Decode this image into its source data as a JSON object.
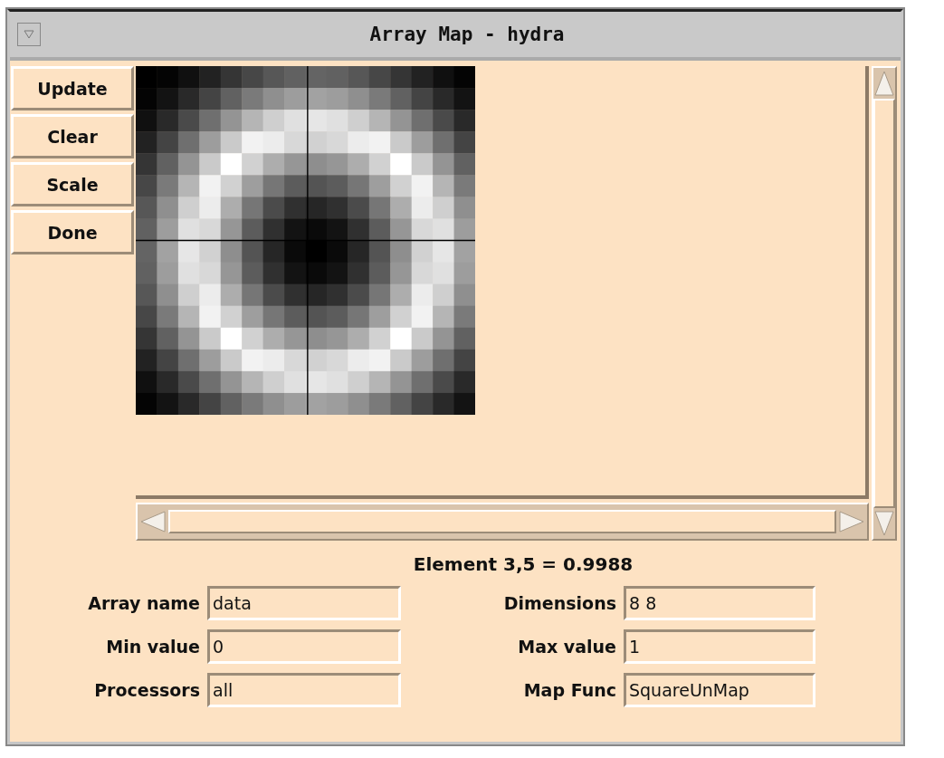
{
  "window": {
    "title": "Array Map - hydra"
  },
  "buttons": [
    "Update",
    "Clear",
    "Scale",
    "Done"
  ],
  "readout": "Element 3,5 = 0.9988",
  "fields": [
    {
      "label": "Array name",
      "value": "data"
    },
    {
      "label": "Dimensions",
      "value": "8 8"
    },
    {
      "label": "Min value",
      "value": "0"
    },
    {
      "label": "Max value",
      "value": "1"
    },
    {
      "label": "Processors",
      "value": "all"
    },
    {
      "label": "Map Func",
      "value": "SquareUnMap"
    }
  ]
}
